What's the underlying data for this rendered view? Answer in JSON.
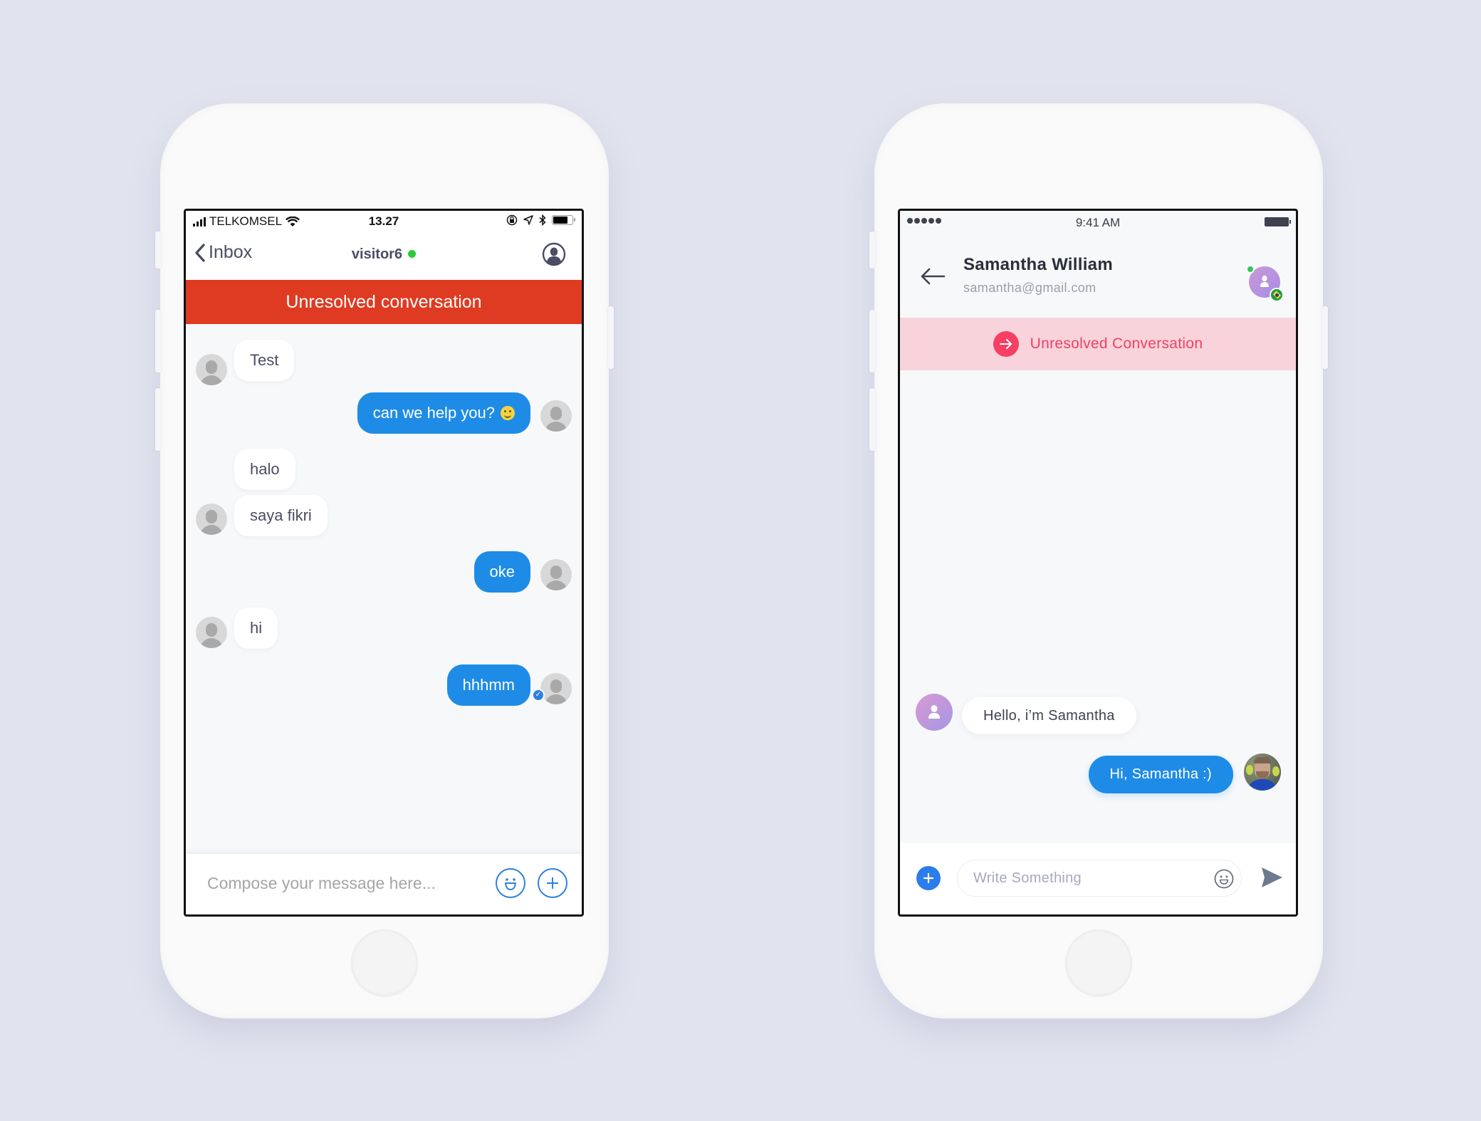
{
  "left_phone": {
    "status_bar": {
      "carrier": "TELKOMSEL",
      "time": "13.27",
      "icons": [
        "signal-icon",
        "wifi-icon",
        "orientation-lock-icon",
        "location-icon",
        "bluetooth-icon",
        "battery-icon"
      ]
    },
    "nav": {
      "back_label": "Inbox",
      "title": "visitor6",
      "online": true,
      "profile_icon": "user-circle-icon"
    },
    "banner": {
      "text": "Unresolved conversation",
      "color": "#DE3B22"
    },
    "messages": [
      {
        "side": "in",
        "text": "Test",
        "avatar": true
      },
      {
        "side": "out",
        "text": "can we help you?",
        "emoji": "slightly-smiling-face",
        "avatar": true
      },
      {
        "side": "in",
        "text": "halo",
        "avatar": false
      },
      {
        "side": "in",
        "text": "saya fikri",
        "avatar": true
      },
      {
        "side": "out",
        "text": "oke",
        "avatar": true
      },
      {
        "side": "in",
        "text": "hi",
        "avatar": true
      },
      {
        "side": "out",
        "text": "hhhmm",
        "avatar": true,
        "read": true
      }
    ],
    "composer": {
      "placeholder": "Compose your message here...",
      "value": "",
      "emoji_button": "emoji-icon",
      "add_button": "plus-icon"
    },
    "accent": "#1E8CE6"
  },
  "right_phone": {
    "status_bar": {
      "time": "9:41 AM",
      "icons": [
        "signal-dots-icon",
        "battery-icon"
      ]
    },
    "header": {
      "name": "Samantha William",
      "email": "samantha@gmail.com",
      "online": true,
      "country_flag": "brazil-flag-icon"
    },
    "banner": {
      "text": "Unresolved Conversation",
      "icon": "arrow-right-icon",
      "color": "#F23F62",
      "background": "#F9D3DB"
    },
    "messages": [
      {
        "side": "in",
        "text": "Hello, i’m Samantha"
      },
      {
        "side": "out",
        "text": "Hi, Samantha :)"
      }
    ],
    "composer": {
      "placeholder": "Write Something",
      "value": "",
      "add_button": "plus-icon",
      "emoji_button": "emoji-icon",
      "send_button": "send-icon"
    },
    "accent": "#1E8CE6"
  }
}
